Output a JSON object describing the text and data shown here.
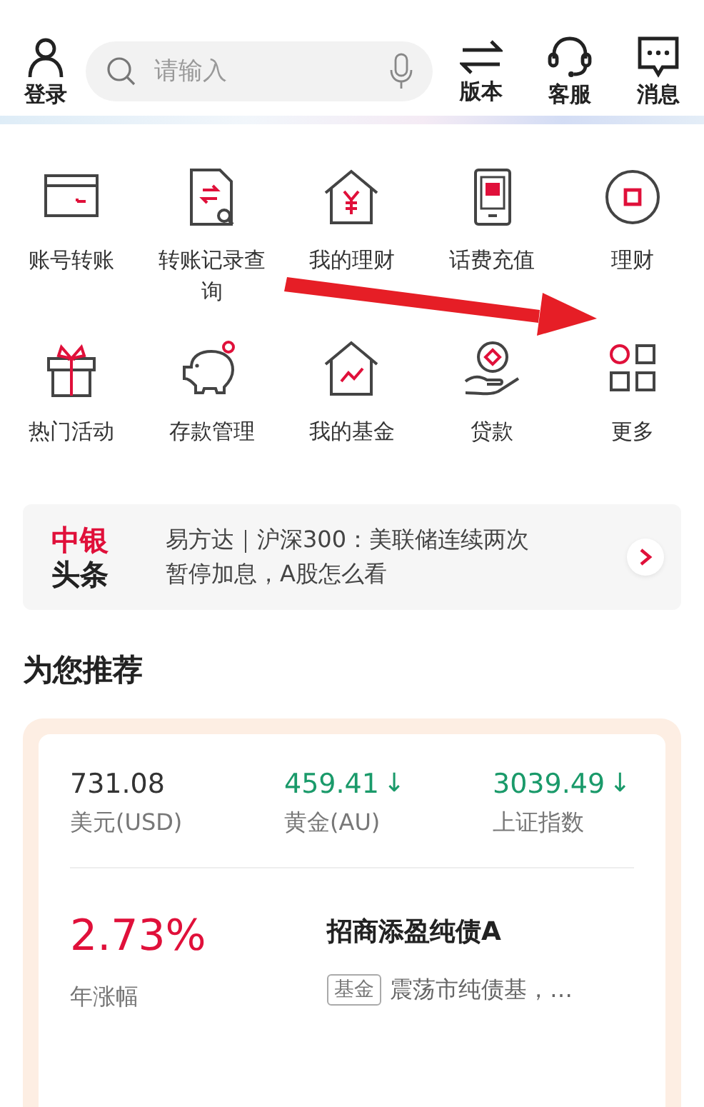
{
  "top_bar": {
    "login": "登录",
    "search": {
      "placeholder": "请输入"
    },
    "actions": [
      {
        "label": "版本",
        "kind": "switch"
      },
      {
        "label": "客服",
        "kind": "headset"
      },
      {
        "label": "消息",
        "kind": "message"
      }
    ]
  },
  "shortcuts": [
    {
      "label": "账号转账",
      "kind": "card"
    },
    {
      "label": "转账记录查询",
      "kind": "record"
    },
    {
      "label": "我的理财",
      "kind": "house-yen"
    },
    {
      "label": "话费充值",
      "kind": "phone"
    },
    {
      "label": "理财",
      "kind": "circle"
    },
    {
      "label": "热门活动",
      "kind": "gift"
    },
    {
      "label": "存款管理",
      "kind": "piggy"
    },
    {
      "label": "我的基金",
      "kind": "house-chart"
    },
    {
      "label": "贷款",
      "kind": "loan"
    },
    {
      "label": "更多",
      "kind": "more"
    }
  ],
  "annotation": {
    "kind": "arrow"
  },
  "headline": {
    "brand_top": "中银",
    "brand_bottom": "头条",
    "text": "易方达｜沪深300：美联储连续两次暂停加息，A股怎么看"
  },
  "recommend": {
    "title": "为您推荐",
    "quotes": [
      {
        "value": "731.08",
        "name": "美元(USD)"
      },
      {
        "value": "459.41",
        "arrow": "↓",
        "name": "黄金(AU)"
      },
      {
        "value": "3039.49",
        "arrow": "↓",
        "name": "上证指数"
      }
    ],
    "funds": [
      {
        "rate": "2.73%",
        "rate_label": "年涨幅",
        "name": "招商添盈纯债A",
        "tag": "基金",
        "desc": "震荡市纯债基，…"
      }
    ]
  }
}
